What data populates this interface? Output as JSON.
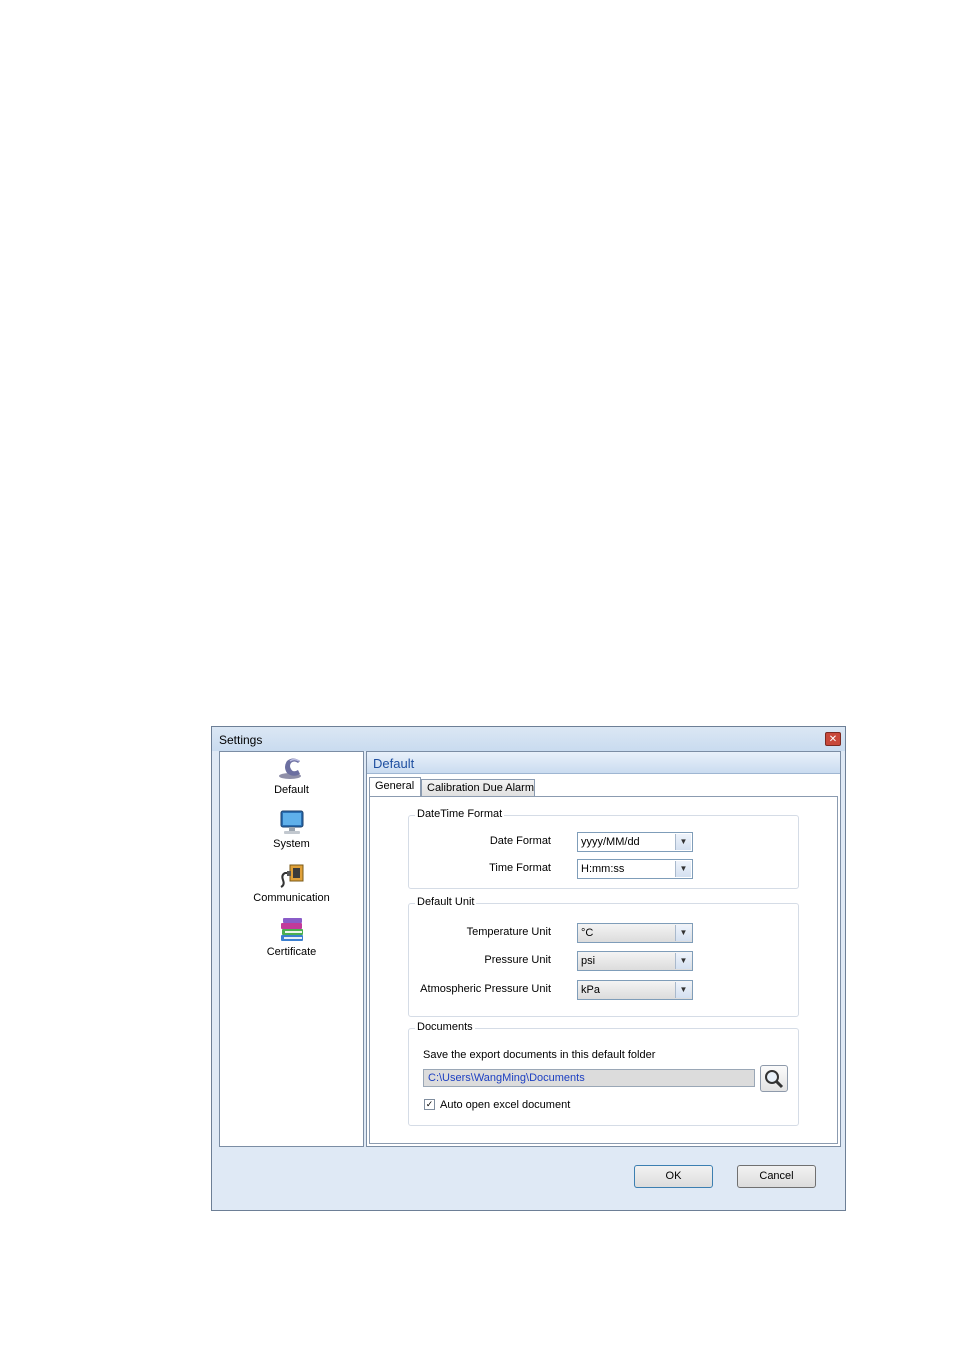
{
  "window": {
    "title": "Settings",
    "close_glyph": "✕"
  },
  "nav": {
    "items": [
      {
        "label": "Default",
        "icon": "default-c-icon"
      },
      {
        "label": "System",
        "icon": "monitor-icon"
      },
      {
        "label": "Communication",
        "icon": "connector-icon"
      },
      {
        "label": "Certificate",
        "icon": "books-icon"
      }
    ]
  },
  "panel": {
    "header": "Default",
    "tabs": [
      {
        "label": "General",
        "active": true
      },
      {
        "label": "Calibration Due Alarm",
        "active": false
      }
    ]
  },
  "datetime": {
    "group_label": "DateTime Format",
    "date_label": "Date Format",
    "date_value": "yyyy/MM/dd",
    "time_label": "Time Format",
    "time_value": "H:mm:ss"
  },
  "units": {
    "group_label": "Default Unit",
    "temperature_label": "Temperature Unit",
    "temperature_value": "°C",
    "pressure_label": "Pressure Unit",
    "pressure_value": "psi",
    "atmospheric_label": "Atmospheric Pressure Unit",
    "atmospheric_value": "kPa"
  },
  "documents": {
    "group_label": "Documents",
    "description": "Save the export documents in this default folder",
    "path": "C:\\Users\\WangMing\\Documents",
    "auto_open_label": "Auto open excel document",
    "auto_open_checked": true
  },
  "buttons": {
    "ok": "OK",
    "cancel": "Cancel"
  },
  "colors": {
    "accent": "#1f4fa0",
    "path_text": "#1c3fc2",
    "close": "#c8483a"
  }
}
